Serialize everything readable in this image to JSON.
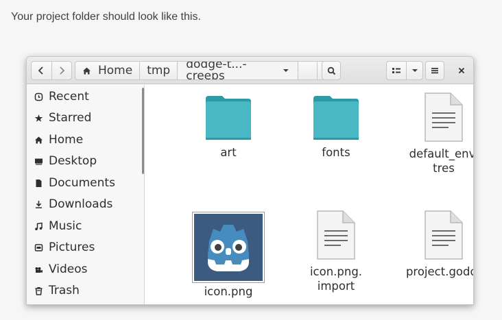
{
  "intro_text": "Your project folder should look like this.",
  "headerbar": {
    "path": [
      {
        "label": "Home",
        "icon": "home-icon"
      },
      {
        "label": "tmp"
      },
      {
        "label": "dodge-t...-creeps",
        "icon": "chevron-down-icon"
      }
    ]
  },
  "sidebar": {
    "items": [
      {
        "label": "Recent",
        "icon": "clock-icon"
      },
      {
        "label": "Starred",
        "icon": "star-icon"
      },
      {
        "label": "Home",
        "icon": "home-icon"
      },
      {
        "label": "Desktop",
        "icon": "desktop-icon"
      },
      {
        "label": "Documents",
        "icon": "document-icon"
      },
      {
        "label": "Downloads",
        "icon": "download-icon"
      },
      {
        "label": "Music",
        "icon": "music-icon"
      },
      {
        "label": "Pictures",
        "icon": "pictures-icon"
      },
      {
        "label": "Videos",
        "icon": "videos-icon"
      },
      {
        "label": "Trash",
        "icon": "trash-icon"
      }
    ]
  },
  "files": [
    {
      "name_lines": [
        "art"
      ],
      "type": "folder"
    },
    {
      "name_lines": [
        "fonts"
      ],
      "type": "folder"
    },
    {
      "name_lines": [
        "default_env.",
        "tres"
      ],
      "type": "document"
    },
    {
      "name_lines": [
        "icon.png"
      ],
      "type": "image"
    },
    {
      "name_lines": [
        "icon.png.",
        "import"
      ],
      "type": "document"
    },
    {
      "name_lines": [
        "project.godot"
      ],
      "type": "document"
    }
  ],
  "colors": {
    "folder": "#4ab8c4",
    "folder_dark": "#2e9aa6",
    "godot_bg": "#3d5a80",
    "godot_blue": "#478cbf"
  }
}
